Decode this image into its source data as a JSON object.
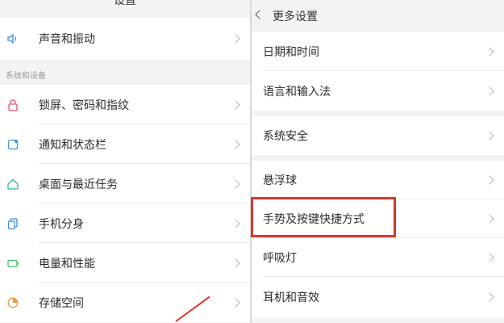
{
  "left_panel": {
    "header": "设置",
    "top_items": [
      {
        "label": "声音和振动",
        "icon": "speaker-icon"
      }
    ],
    "section_title": "系统和设备",
    "items": [
      {
        "label": "锁屏、密码和指纹",
        "icon": "lock-icon"
      },
      {
        "label": "通知和状态栏",
        "icon": "notification-icon"
      },
      {
        "label": "桌面与最近任务",
        "icon": "home-icon"
      },
      {
        "label": "手机分身",
        "icon": "clone-icon"
      },
      {
        "label": "电量和性能",
        "icon": "battery-icon"
      },
      {
        "label": "存储空间",
        "icon": "storage-icon"
      }
    ]
  },
  "right_panel": {
    "header": "更多设置",
    "groups": [
      [
        {
          "label": "日期和时间"
        },
        {
          "label": "语言和输入法"
        }
      ],
      [
        {
          "label": "系统安全"
        }
      ],
      [
        {
          "label": "悬浮球"
        },
        {
          "label": "手势及按键快捷方式"
        },
        {
          "label": "呼吸灯"
        },
        {
          "label": "耳机和音效"
        }
      ]
    ]
  },
  "colors": {
    "icon_red": "#e0526a",
    "icon_blue": "#3d8fe0",
    "icon_teal": "#2fb8a5",
    "icon_green": "#3fbf74",
    "icon_orange": "#f09a3e",
    "highlight": "#d8382c"
  }
}
